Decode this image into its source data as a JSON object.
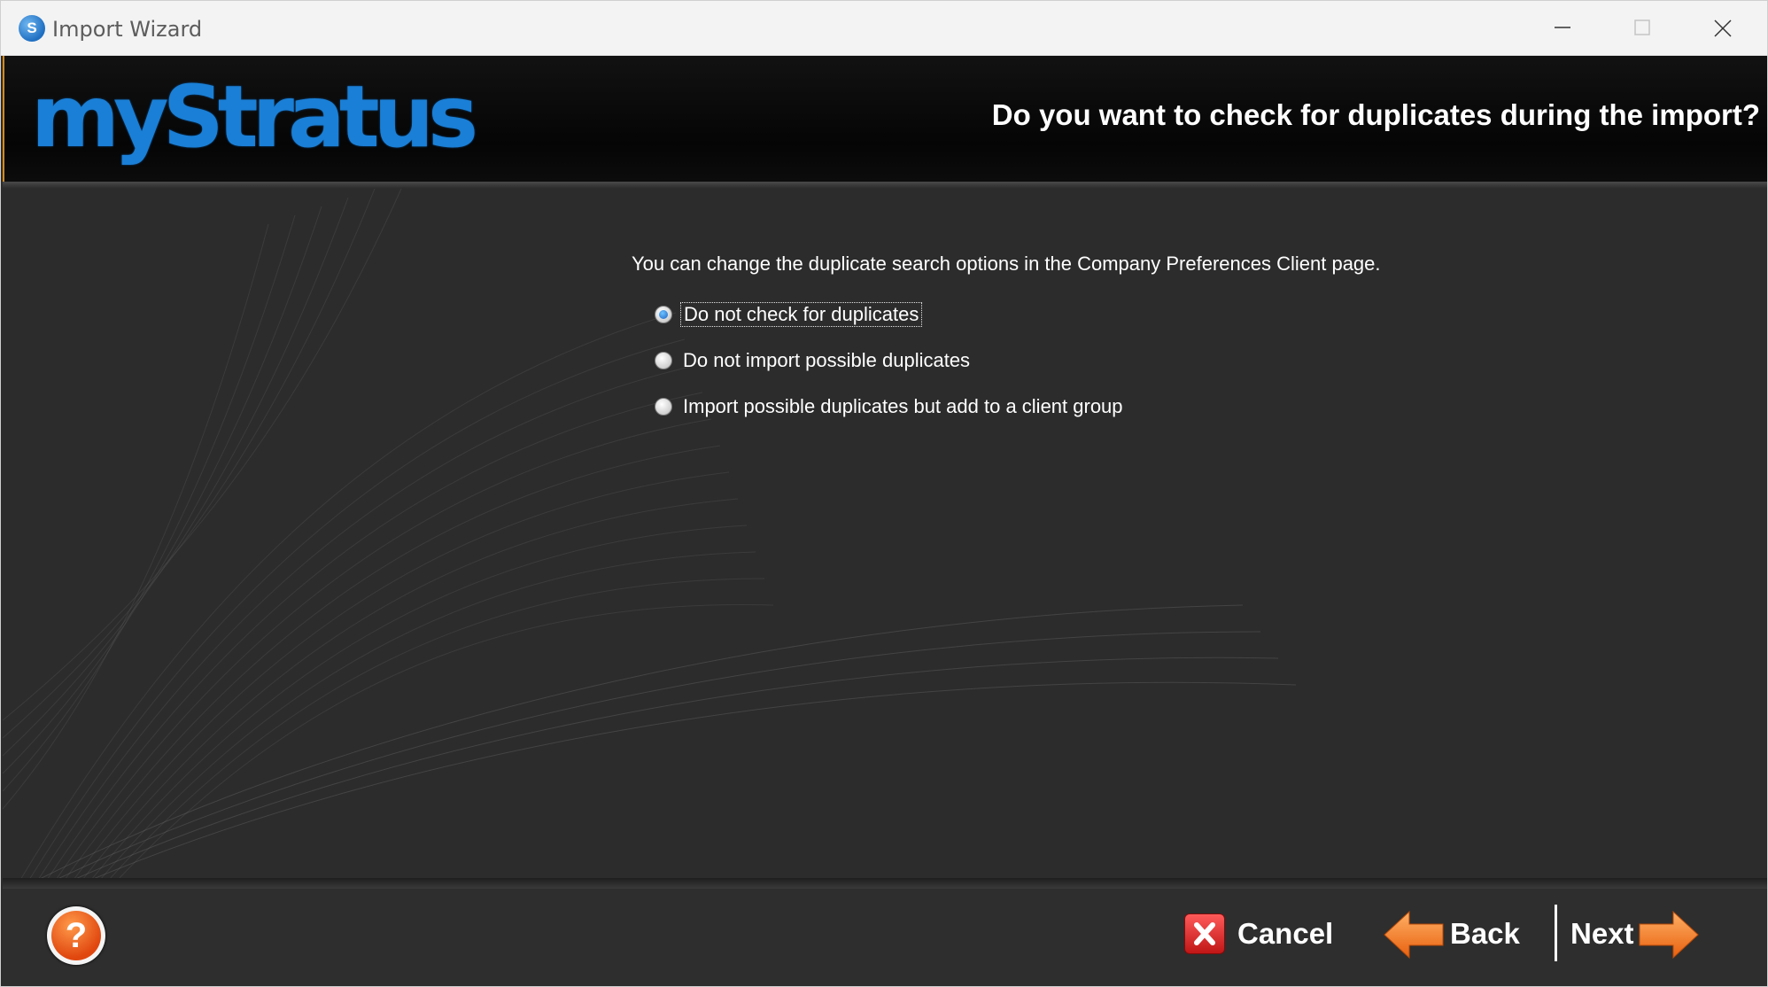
{
  "window": {
    "title": "Import Wizard",
    "app_icon_glyph": "S"
  },
  "header": {
    "logo": "myStratus",
    "question": "Do you want to check for duplicates during the import?"
  },
  "content": {
    "info": "You can change the duplicate search options in the Company Preferences Client page.",
    "options": [
      {
        "label": "Do not check for duplicates",
        "selected": true
      },
      {
        "label": "Do not import possible duplicates",
        "selected": false
      },
      {
        "label": "Import possible duplicates but add to a client group",
        "selected": false
      }
    ]
  },
  "footer": {
    "help_glyph": "?",
    "cancel_label": "Cancel",
    "back_label": "Back",
    "next_label": "Next"
  },
  "colors": {
    "logo_blue": "#1a7fd6",
    "accent_orange": "#f07a1e",
    "cancel_red": "#d32020"
  },
  "icons": {
    "app": "stratus-logo-icon",
    "minimize": "minimize-icon",
    "maximize": "maximize-icon",
    "close": "close-icon",
    "help": "help-icon",
    "cancel": "cancel-x-icon",
    "back": "arrow-left-icon",
    "next": "arrow-right-icon"
  }
}
